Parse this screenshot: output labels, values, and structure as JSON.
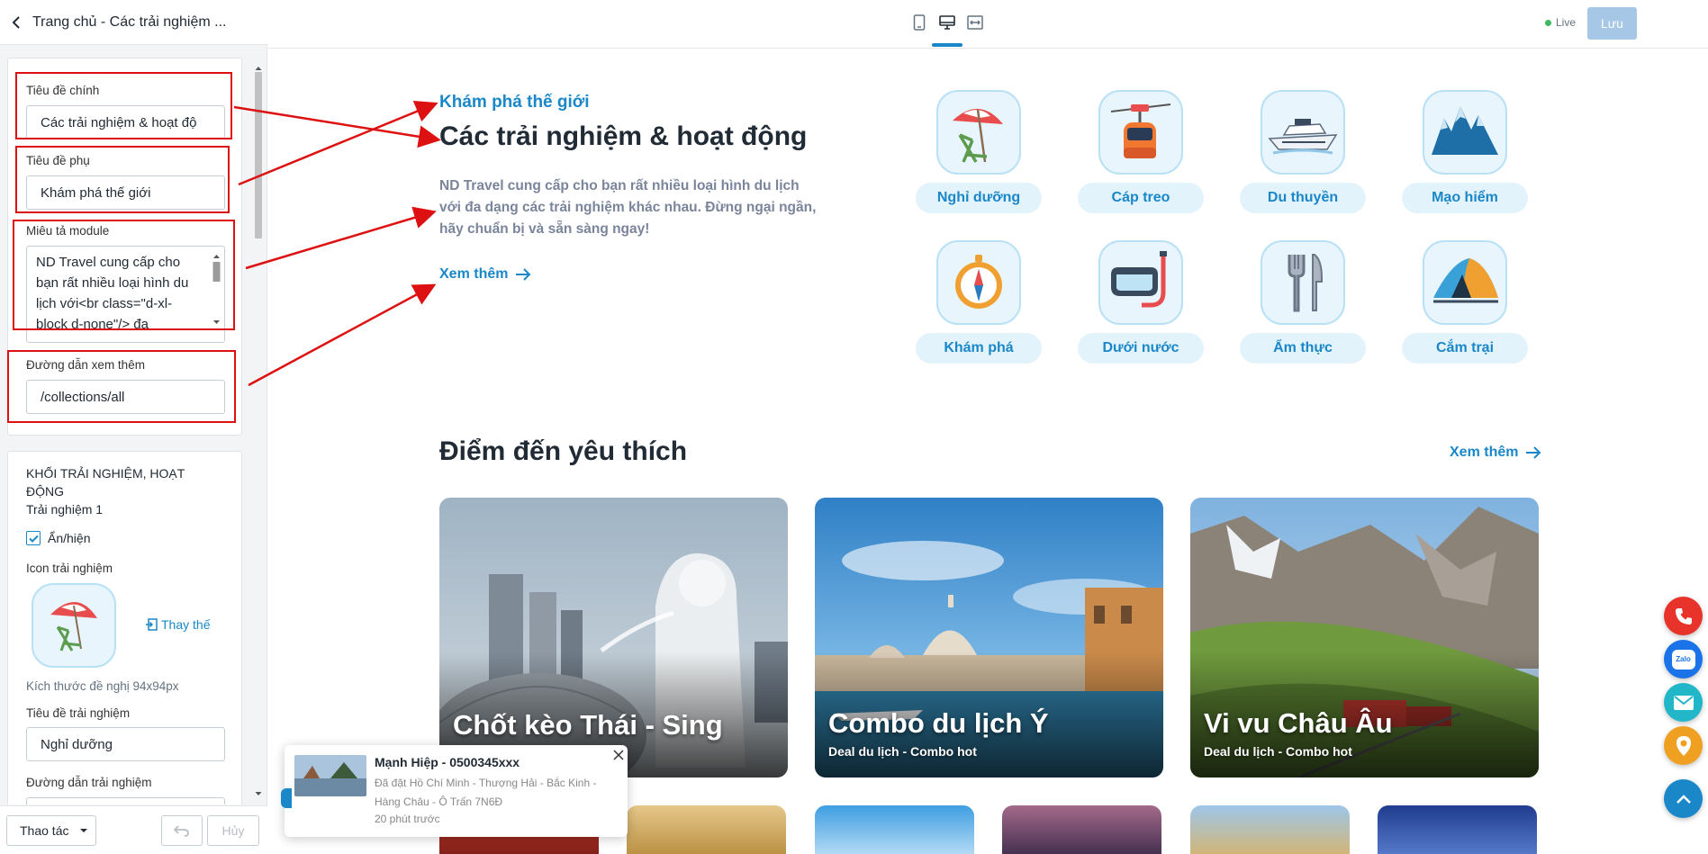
{
  "panel": {
    "title": "Trang chủ - Các trải nghiệm ...",
    "fields": {
      "main_title_label": "Tiêu đề chính",
      "main_title_value": "Các trải nghiệm & hoạt độ",
      "subtitle_label": "Tiêu đề phụ",
      "subtitle_value": "Khám phá thế giới",
      "desc_label": "Miêu tả module",
      "desc_value": "ND Travel cung cấp cho bạn rất nhiều loại hình du lịch với<br class=\"d-xl-block d-none\"/> đa",
      "link_label": "Đường dẫn xem thêm",
      "link_value": "/collections/all"
    },
    "block": {
      "heading": "KHỐI TRẢI NGHIỆM, HOẠT ĐỘNG",
      "item_title": "Trải nghiệm 1",
      "toggle_label": "Ẩn/hiện",
      "toggle_checked": true,
      "icon_label": "Icon trải nghiệm",
      "replace_label": "Thay thế",
      "size_hint": "Kích thước đề nghị 94x94px",
      "exp_title_label": "Tiêu đề trải nghiệm",
      "exp_title_value": "Nghỉ dưỡng",
      "exp_link_label": "Đường dẫn trải nghiệm"
    },
    "footer": {
      "actions_label": "Thao tác",
      "cancel_label": "Hủy"
    }
  },
  "topbar": {
    "live_label": "Live",
    "save_label": "Lưu",
    "accent": "#1a87c9",
    "save_bg": "#a6c7e6",
    "live_dot": "#3dba5e"
  },
  "section1": {
    "subtitle": "Khám phá thế giới",
    "title": "Các trải nghiệm & hoạt động",
    "description": "ND Travel cung cấp cho bạn rất nhiều loại hình du lịch với đa dạng các trải nghiệm khác nhau. Đừng ngại ngần, hãy chuẩn bị và sẵn sàng ngay!",
    "more": "Xem thêm",
    "experiences": [
      {
        "label": "Nghỉ dưỡng",
        "icon": "beach-chair-icon"
      },
      {
        "label": "Cáp treo",
        "icon": "cable-car-icon"
      },
      {
        "label": "Du thuyền",
        "icon": "yacht-icon"
      },
      {
        "label": "Mạo hiểm",
        "icon": "mountain-icon"
      },
      {
        "label": "Khám phá",
        "icon": "compass-icon"
      },
      {
        "label": "Dưới nước",
        "icon": "diving-mask-icon"
      },
      {
        "label": "Ẩm thực",
        "icon": "cutlery-icon"
      },
      {
        "label": "Cắm trại",
        "icon": "tent-icon"
      }
    ]
  },
  "section2": {
    "title": "Điểm đến yêu thích",
    "more": "Xem thêm",
    "destinations": [
      {
        "title": "Chốt kèo Thái - Sing",
        "subtitle": "Deal du lịch - Combo hot"
      },
      {
        "title": "Combo du lịch Ý",
        "subtitle": "Deal du lịch - Combo hot"
      },
      {
        "title": "Vi vu Châu Âu",
        "subtitle": "Deal du lịch - Combo hot"
      }
    ]
  },
  "notification": {
    "name": "Mạnh Hiệp - 0500345xxx",
    "detail": "Đã đặt Hồ Chí Minh - Thượng Hải - Bắc Kinh - Hàng Châu - Ô Trấn 7N6Đ",
    "time": "20 phút trước"
  },
  "contact_buttons": [
    "phone-icon",
    "zalo-icon",
    "mail-icon",
    "map-pin-icon",
    "scroll-top-icon"
  ]
}
